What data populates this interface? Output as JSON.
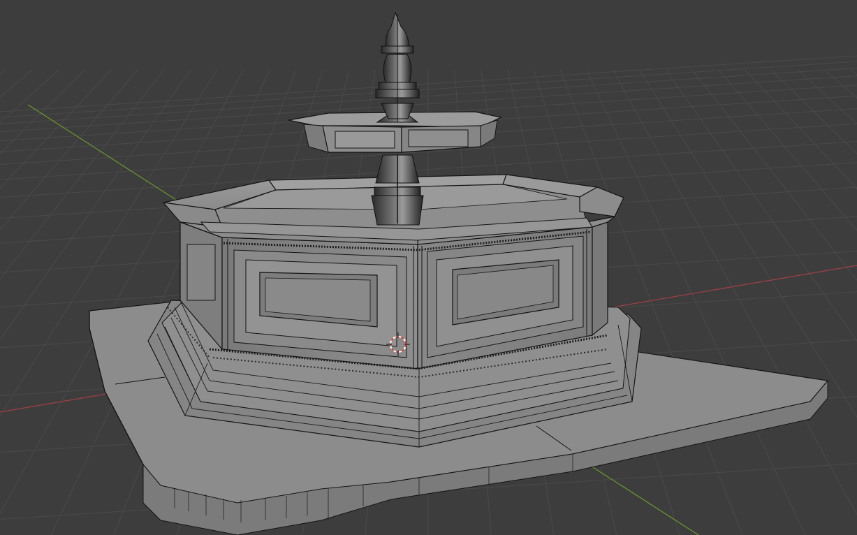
{
  "app": {
    "title": ""
  },
  "viewport": {
    "background_color": "#3d3d3d",
    "grid_color": "#4a4a4a",
    "x_axis_color": "#a33f47",
    "y_axis_color": "#6a9a2e",
    "mesh_fill": "#8c8c8c",
    "mesh_dark": "#5a5a5a",
    "wire_color": "#101010",
    "cursor_color": "#d83a2a",
    "object": "fountain-mesh",
    "shading": "solid-wireframe"
  }
}
